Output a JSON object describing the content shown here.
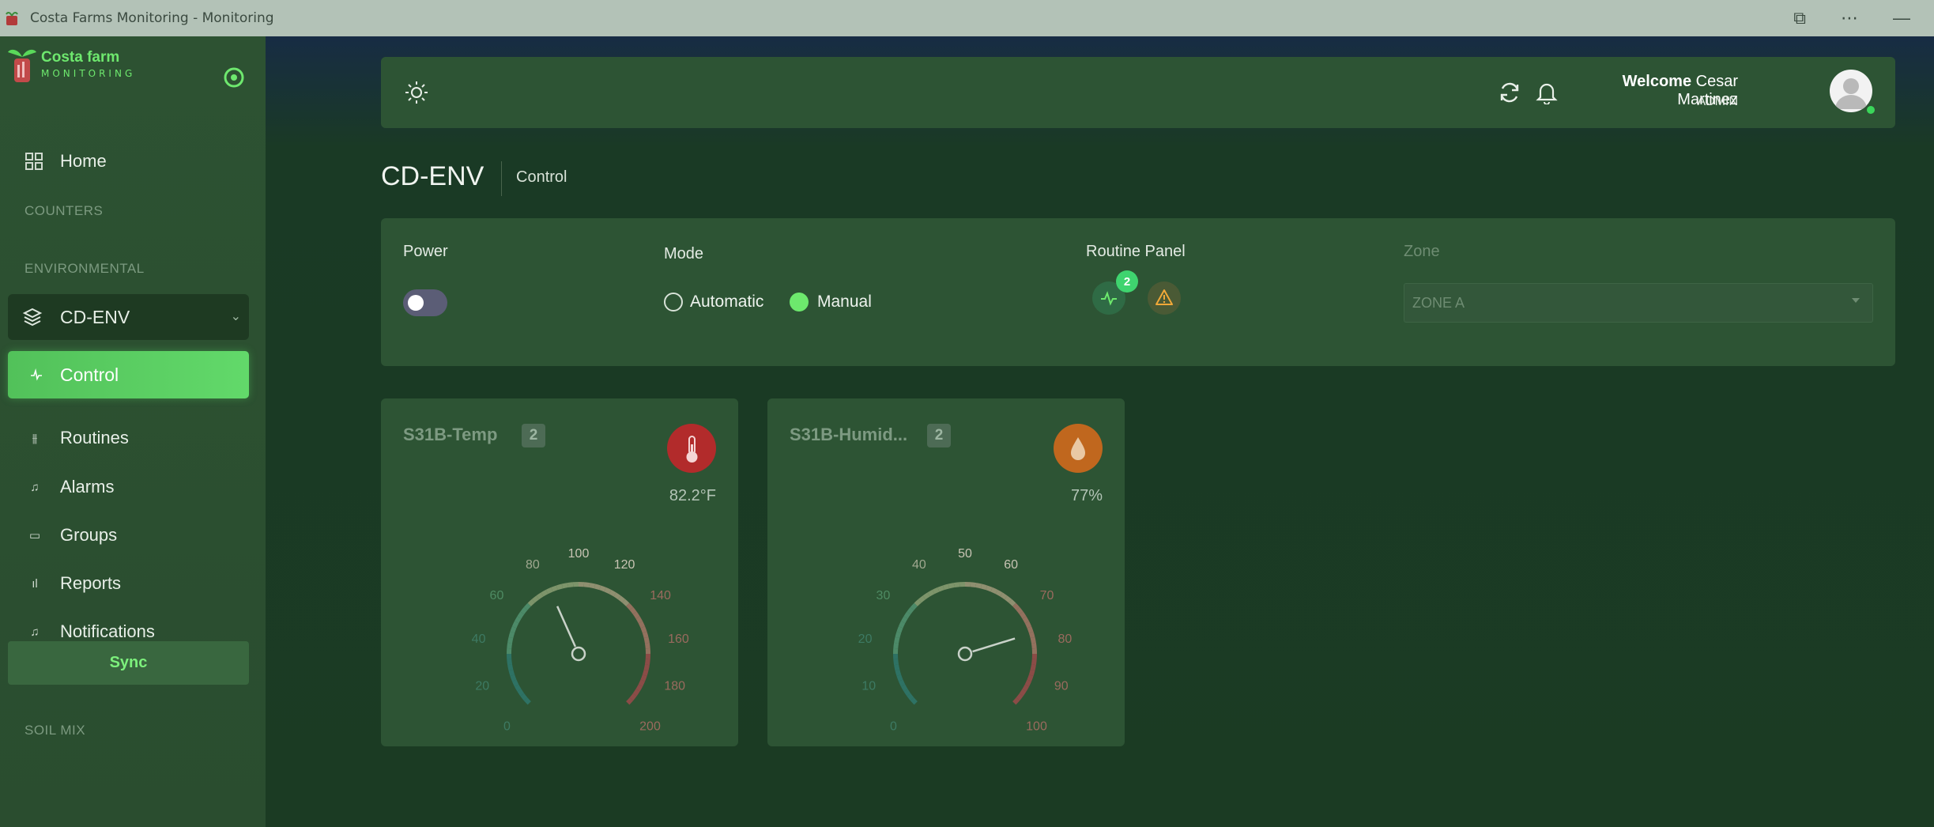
{
  "window": {
    "title": "Costa Farms Monitoring - Monitoring"
  },
  "brand": {
    "name": "Costa farm",
    "sub": "MONITORING"
  },
  "sidebar": {
    "home": "Home",
    "sections": {
      "counters": "COUNTERS",
      "environmental": "ENVIRONMENTAL",
      "soil_mix": "SOIL MIX"
    },
    "group": "CD-ENV",
    "items": [
      "Control",
      "Routines",
      "Alarms",
      "Groups",
      "Reports",
      "Notifications"
    ],
    "sync": "Sync"
  },
  "header": {
    "welcome": "Welcome",
    "user": "Cesar Martinez",
    "role": "ADMIN"
  },
  "page": {
    "title": "CD-ENV",
    "breadcrumb": "Control"
  },
  "controls": {
    "power_label": "Power",
    "power_on": false,
    "mode_label": "Mode",
    "mode_options": [
      "Automatic",
      "Manual"
    ],
    "mode_selected": "Manual",
    "routine_label": "Routine Panel",
    "routine_badge": "2",
    "zone_label": "Zone",
    "zone_value": "ZONE A"
  },
  "sensors": [
    {
      "name": "S31B-Temp",
      "count": "2",
      "icon": "thermometer-icon",
      "reading": "82.2°F",
      "gauge": {
        "min": 0,
        "max": 200,
        "value": 82.2,
        "ticks": [
          "0",
          "20",
          "40",
          "60",
          "80",
          "100",
          "120",
          "140",
          "160",
          "180",
          "200"
        ]
      },
      "color": "#b22b2b"
    },
    {
      "name": "S31B-Humid...",
      "count": "2",
      "icon": "water-drop-icon",
      "reading": "77%",
      "gauge": {
        "min": 0,
        "max": 100,
        "value": 77,
        "ticks": [
          "0",
          "10",
          "20",
          "30",
          "40",
          "50",
          "60",
          "70",
          "80",
          "90",
          "100"
        ]
      },
      "color": "#c0671e"
    }
  ]
}
